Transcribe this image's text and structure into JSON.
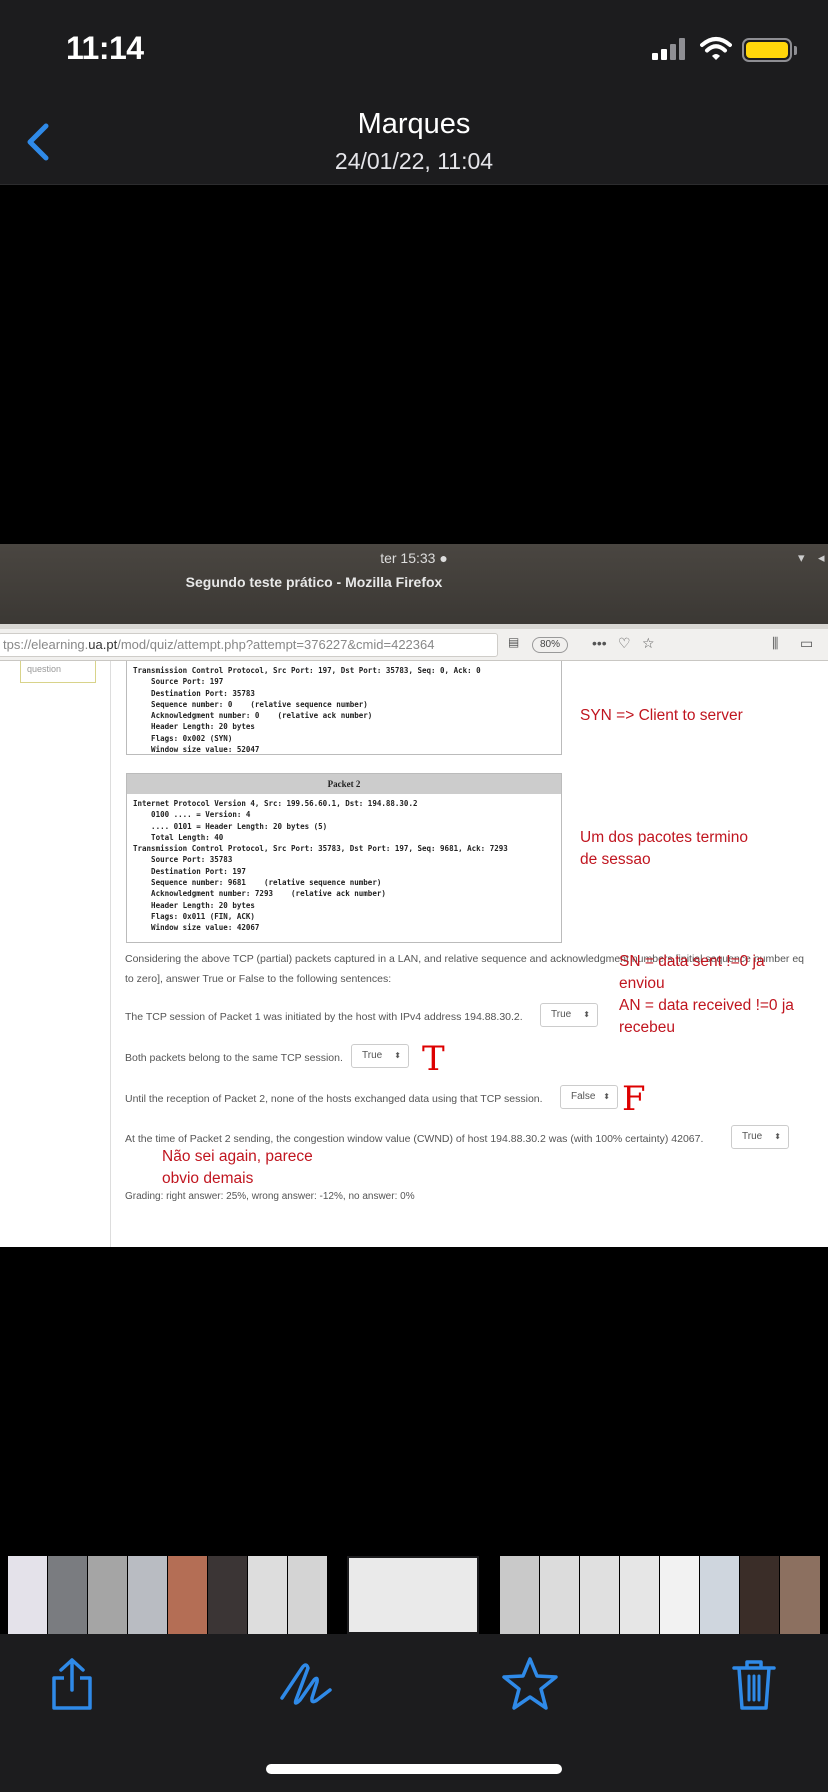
{
  "status_bar": {
    "time": "11:14"
  },
  "nav": {
    "title": "Marques",
    "subtitle": "24/01/22, 11:04"
  },
  "photo": {
    "system_clock": "ter 15:33 ●",
    "window_title": "Segundo teste prático - Mozilla Firefox",
    "url_prefix": "tps://elearning.",
    "url_domain": "ua.pt",
    "url_rest": "/mod/quiz/attempt.php?attempt=376227&cmid=422364",
    "zoom": "80%",
    "question_box": "question",
    "packet1_lines": [
      "Transmission Control Protocol, Src Port: 197, Dst Port: 35783, Seq: 0, Ack: 0",
      "    Source Port: 197",
      "    Destination Port: 35783",
      "    Sequence number: 0    (relative sequence number)",
      "    Acknowledgment number: 0    (relative ack number)",
      "    Header Length: 20 bytes",
      "    Flags: 0x002 (SYN)",
      "    Window size value: 52047"
    ],
    "packet2_title": "Packet 2",
    "packet2_lines": [
      "Internet Protocol Version 4, Src: 199.56.60.1, Dst: 194.88.30.2",
      "    0100 .... = Version: 4",
      "    .... 0101 = Header Length: 20 bytes (5)",
      "    Total Length: 40",
      "Transmission Control Protocol, Src Port: 35783, Dst Port: 197, Seq: 9681, Ack: 7293",
      "    Source Port: 35783",
      "    Destination Port: 197",
      "    Sequence number: 9681    (relative sequence number)",
      "    Acknowledgment number: 7293    (relative ack number)",
      "    Header Length: 20 bytes",
      "    Flags: 0x011 (FIN, ACK)",
      "    Window size value: 42067"
    ],
    "intro_line1": "Considering the above TCP (partial) packets captured in a LAN, and relative sequence and acknowledgment numbers [initial sequence number eq",
    "intro_line2": "to zero], answer True or False to the following sentences:",
    "questions": [
      {
        "text": "The TCP session of Packet 1 was initiated by the host with IPv4 address 194.88.30.2.",
        "answer": "True"
      },
      {
        "text": "Both packets belong to the same TCP session.",
        "answer": "True"
      },
      {
        "text": "Until the reception of Packet 2, none of the hosts exchanged data using that TCP session.",
        "answer": "False"
      },
      {
        "text": "At the time of Packet 2 sending, the congestion window value (CWND) of host 194.88.30.2 was (with 100% certainty) 42067.",
        "answer": "True"
      }
    ],
    "grading": "Grading: right answer: 25%, wrong answer: -12%, no answer: 0%",
    "notes": {
      "syn": "SYN => Client to server",
      "pacotes_l1": "Um dos pacotes termino",
      "pacotes_l2": "de sessao",
      "sn_l1": "SN = data sent !=0 ja",
      "sn_l2": "enviou",
      "an_l1": "AN = data received !=0 ja",
      "an_l2": "recebeu",
      "naosei_l1": "Não sei again, parece",
      "naosei_l2": "obvio demais"
    },
    "hand_marks": {
      "t": "T",
      "f": "F"
    }
  },
  "colors": {
    "ios_blue": "#2f8ae8",
    "note_red": "#c0151f",
    "battery": "#ffd60a"
  },
  "icons": [
    "back-chevron-icon",
    "share-icon",
    "markup-icon",
    "favorite-star-icon",
    "trash-icon"
  ]
}
